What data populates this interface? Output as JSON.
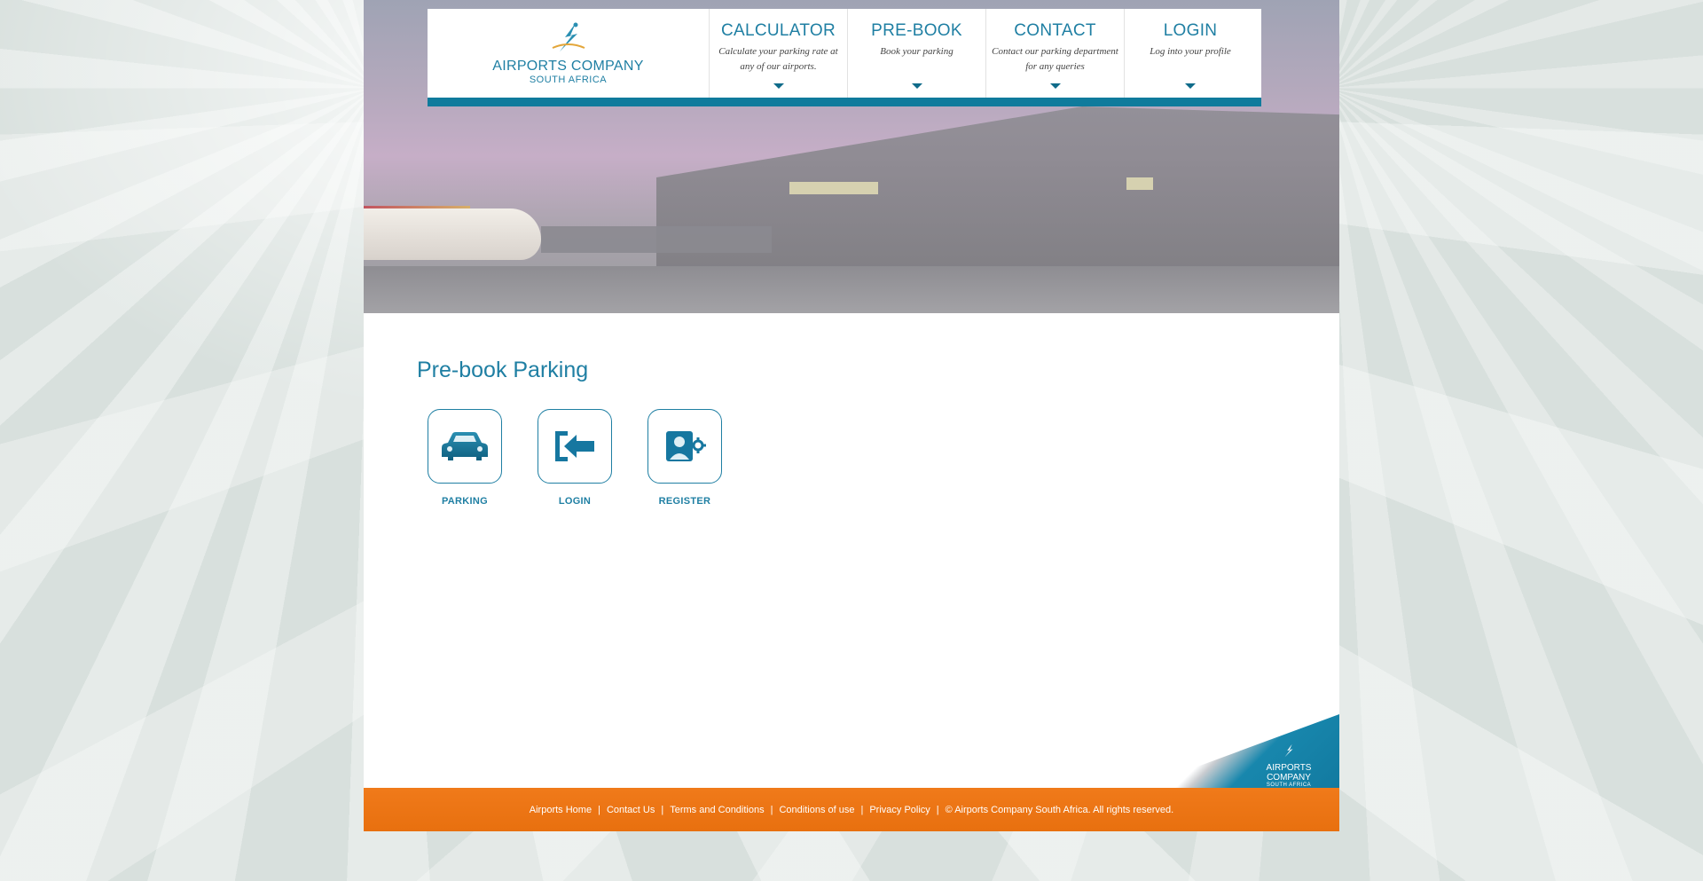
{
  "logo": {
    "name": "AIRPORTS COMPANY",
    "sub": "SOUTH AFRICA"
  },
  "nav": [
    {
      "title": "CALCULATOR",
      "desc": "Calculate your parking rate at any of our airports."
    },
    {
      "title": "PRE-BOOK",
      "desc": "Book your parking"
    },
    {
      "title": "CONTACT",
      "desc": "Contact our parking department for any queries"
    },
    {
      "title": "LOGIN",
      "desc": "Log into your profile"
    }
  ],
  "content": {
    "title": "Pre-book Parking",
    "tiles": [
      {
        "label": "PARKING",
        "icon": "car-icon"
      },
      {
        "label": "LOGIN",
        "icon": "login-arrow-icon"
      },
      {
        "label": "REGISTER",
        "icon": "user-profile-icon"
      }
    ]
  },
  "corner_logo": {
    "name": "AIRPORTS COMPANY",
    "sub": "SOUTH AFRICA"
  },
  "footer": {
    "links": [
      "Airports Home",
      "Contact Us",
      "Terms and Conditions",
      "Conditions of use",
      "Privacy Policy"
    ],
    "copyright": "© Airports Company South Africa. All rights reserved."
  },
  "colors": {
    "brand_blue": "#1f7fa3",
    "nav_bar": "#0f7b9c",
    "footer_orange": "#f07a1a"
  }
}
